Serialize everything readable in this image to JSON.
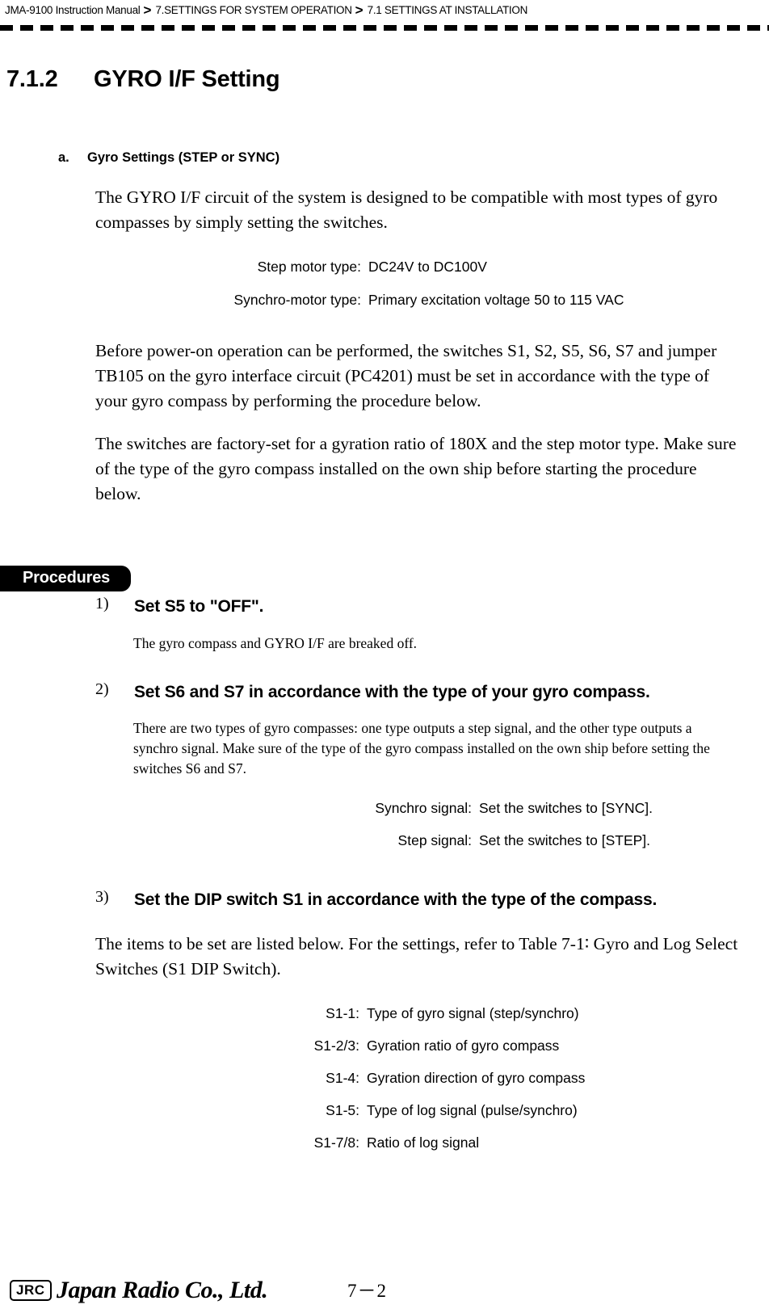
{
  "header": {
    "crumbs": [
      "JMA-9100 Instruction Manual",
      "7.SETTINGS FOR SYSTEM OPERATION",
      "7.1  SETTINGS AT INSTALLATION"
    ],
    "separator": ">"
  },
  "section": {
    "number": "7.1.2",
    "title": "GYRO I/F Setting"
  },
  "subsection": {
    "label": "a.",
    "title": "Gyro Settings (STEP or SYNC)",
    "intro": "The GYRO I/F circuit of the system is designed to be compatible with most types of gyro compasses by simply setting the switches.",
    "motor_types": [
      {
        "key": "Step motor type:",
        "value": "DC24V to DC100V"
      },
      {
        "key": "Synchro-motor type:",
        "value": "Primary excitation voltage 50 to 115 VAC"
      }
    ],
    "para_switches": "Before power-on operation can be performed, the switches S1, S2, S5, S6, S7 and jumper TB105 on the gyro interface circuit (PC4201) must be set in accordance with the type of your gyro compass by performing the procedure below.",
    "para_factory": "The switches are factory-set for a gyration ratio of 180X and the step motor type. Make sure of the type of the gyro compass installed on the own ship before starting the procedure below."
  },
  "procedures": {
    "badge": "Procedures",
    "steps": [
      {
        "number": "1)",
        "title": "Set S5 to \"OFF\".",
        "note": "The gyro compass and GYRO I/F are breaked off."
      },
      {
        "number": "2)",
        "title": "Set S6 and S7 in accordance with the type of your gyro compass.",
        "note": "There are two types of gyro compasses: one type outputs a step signal, and the other type outputs a synchro signal. Make sure of the type of the gyro compass installed on the own ship before setting the switches S6 and S7."
      },
      {
        "number": "3)",
        "title": "Set the DIP switch S1 in accordance with the type of the compass.",
        "note": "The items to be set are listed below. For the settings, refer to Table 7-1∶ Gyro and Log Select Switches (S1 DIP Switch)."
      }
    ],
    "signal_types": [
      {
        "key": "Synchro signal:",
        "value": "Set the switches to [SYNC]."
      },
      {
        "key": "Step signal:",
        "value": "Set the switches to [STEP]."
      }
    ],
    "s1_items": [
      {
        "key": "S1-1:",
        "value": "Type of gyro signal (step/synchro)"
      },
      {
        "key": "S1-2/3:",
        "value": "Gyration ratio of gyro compass"
      },
      {
        "key": "S1-4:",
        "value": "Gyration direction of gyro compass"
      },
      {
        "key": "S1-5:",
        "value": "Type of log signal (pulse/synchro)"
      },
      {
        "key": "S1-7/8:",
        "value": "Ratio of log signal"
      }
    ]
  },
  "footer": {
    "logo_mark": "JRC",
    "logo_word": "Japan Radio Co., Ltd.",
    "page": "7－2"
  }
}
